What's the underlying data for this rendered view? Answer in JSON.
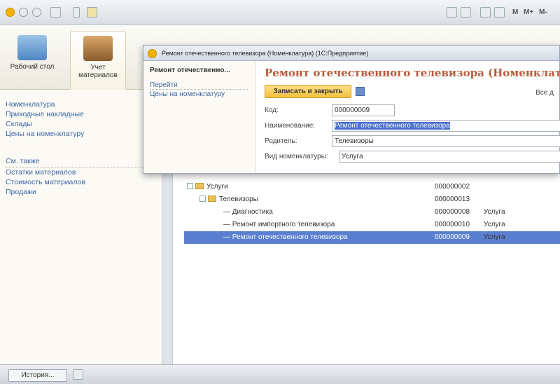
{
  "sections": [
    {
      "label": "Рабочий стол"
    },
    {
      "label": "Учет материалов"
    }
  ],
  "toolbar": {
    "m_label": "M",
    "mplus_label": "M+",
    "mminus_label": "M-"
  },
  "nav": {
    "links": [
      "Номенклатура",
      "Приходные накладные",
      "Склады",
      "Цены на номенклатуру"
    ],
    "see_also_header": "См. также",
    "see_also": [
      "Остатки материалов",
      "Стоимость материалов",
      "Продажи"
    ]
  },
  "list": {
    "rows": [
      {
        "name": "Услуги",
        "code": "000000002",
        "type": ""
      },
      {
        "name": "Телевизоры",
        "code": "000000013",
        "type": ""
      },
      {
        "name": "Диагностика",
        "code": "000000008",
        "type": "Услуга"
      },
      {
        "name": "Ремонт импортного телевизора",
        "code": "000000010",
        "type": "Услуга"
      },
      {
        "name": "Ремонт отечественного телевизора",
        "code": "000000009",
        "type": "Услуга"
      }
    ]
  },
  "status": {
    "history_label": "История..."
  },
  "dialog": {
    "window_title": "Ремонт отечественного телевизора (Номенклатура) (1С:Предприятие)",
    "nav_title": "Ремонт отечественно...",
    "go_to": "Перейти",
    "prices_link": "Цены на номенклатуру",
    "heading": "Ремонт отечественного телевизора (Номенклатура)",
    "save_close_label": "Записать и закрыть",
    "all_actions": "Все д",
    "fields": {
      "code_label": "Код:",
      "code_value": "000000009",
      "name_label": "Наименование:",
      "name_value": "Ремонт отечественного телевизора",
      "parent_label": "Родитель:",
      "parent_value": "Телевизоры",
      "kind_label": "Вид номенклатуры:",
      "kind_value": "Услуга"
    }
  },
  "colors": {
    "accent": "#b65c3a",
    "selection": "#5b7fd0",
    "button": "#f3c23b",
    "link": "#3f67a8"
  }
}
